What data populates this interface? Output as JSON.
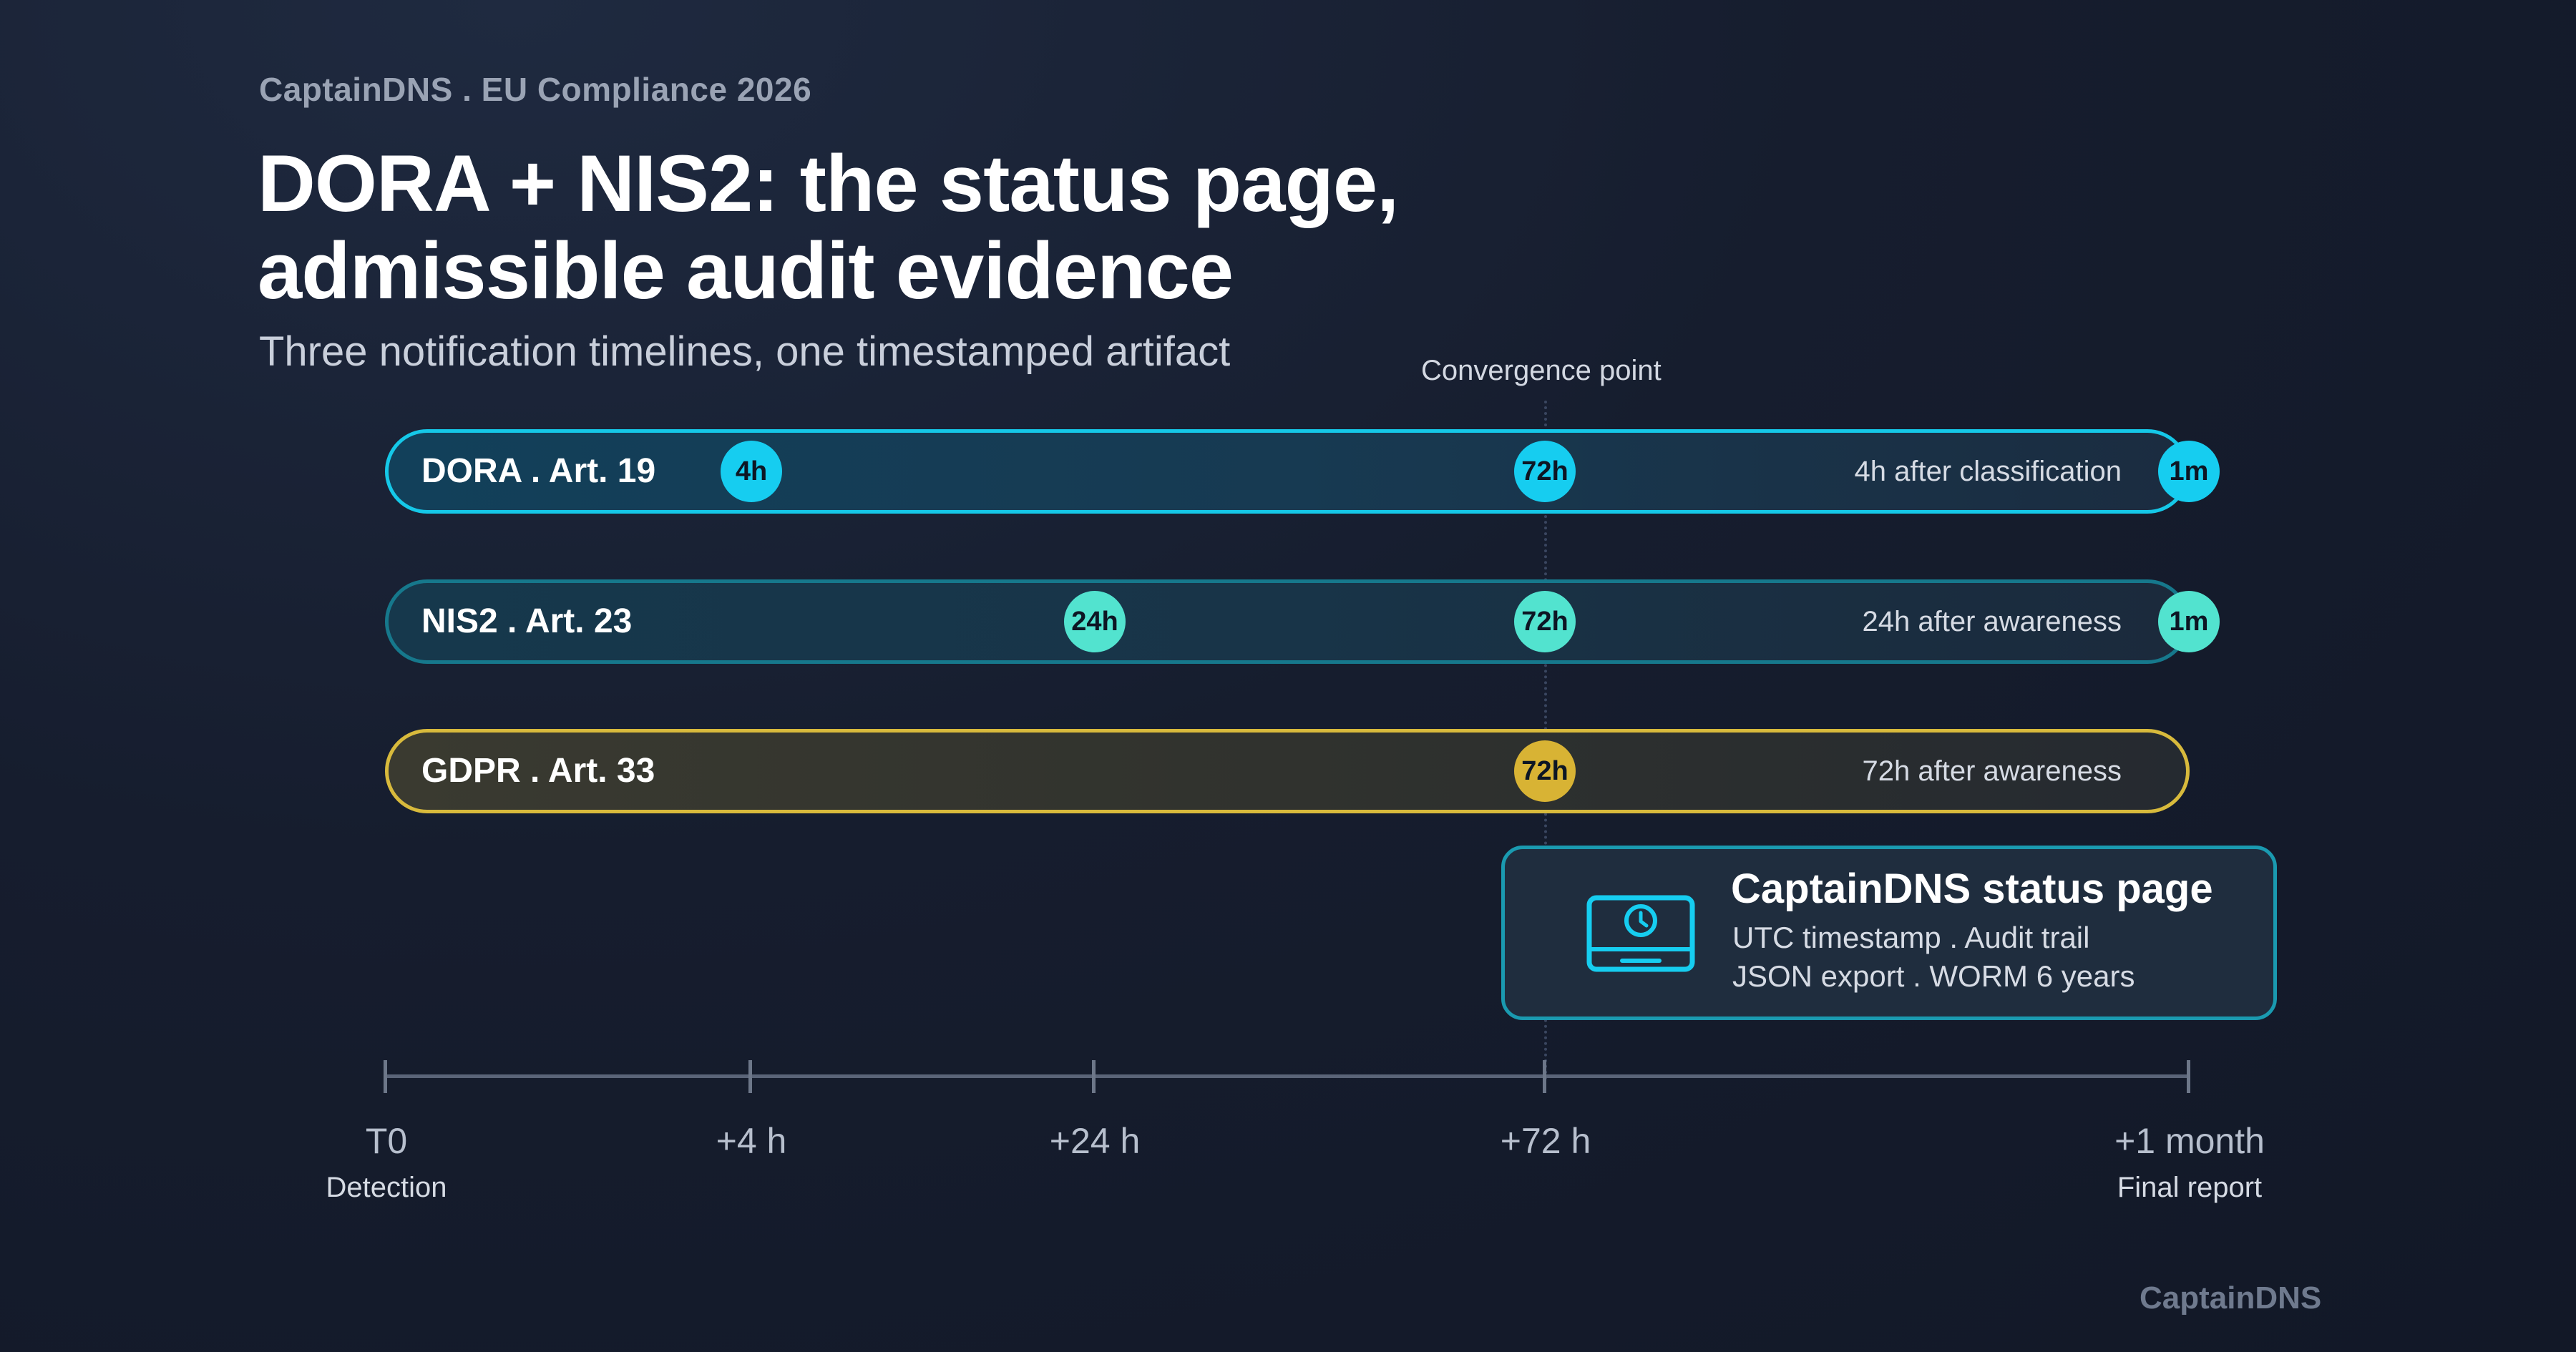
{
  "eyebrow": "CaptainDNS . EU Compliance 2026",
  "title_line1": "DORA + NIS2: the status page,",
  "title_line2": "admissible audit evidence",
  "subtitle": "Three notification timelines, one timestamped artifact",
  "convergence_label": "Convergence point",
  "lanes": [
    {
      "label": "DORA . Art. 19",
      "description": "4h after classification",
      "markers": [
        {
          "text": "4h",
          "color": "cyan"
        },
        {
          "text": "72h",
          "color": "cyan"
        },
        {
          "text": "1m",
          "color": "cyan"
        }
      ]
    },
    {
      "label": "NIS2 . Art. 23",
      "description": "24h after awareness",
      "markers": [
        {
          "text": "24h",
          "color": "teal"
        },
        {
          "text": "72h",
          "color": "teal"
        },
        {
          "text": "1m",
          "color": "teal"
        }
      ]
    },
    {
      "label": "GDPR . Art. 33",
      "description": "72h after awareness",
      "markers": [
        {
          "text": "72h",
          "color": "gold"
        }
      ]
    }
  ],
  "card": {
    "icon": "monitor-clock-icon",
    "title": "CaptainDNS status page",
    "line1": "UTC timestamp . Audit trail",
    "line2": "JSON export . WORM 6 years"
  },
  "axis": {
    "ticks": [
      {
        "label": "T0",
        "sub": "Detection"
      },
      {
        "label": "+4 h",
        "sub": ""
      },
      {
        "label": "+24 h",
        "sub": ""
      },
      {
        "label": "+72 h",
        "sub": ""
      },
      {
        "label": "+1 month",
        "sub": "Final report"
      }
    ]
  },
  "footer": "CaptainDNS",
  "colors": {
    "cyan": "#16cdf0",
    "teal": "#52e3cf",
    "gold": "#d8b334",
    "background": "#161d2e"
  }
}
